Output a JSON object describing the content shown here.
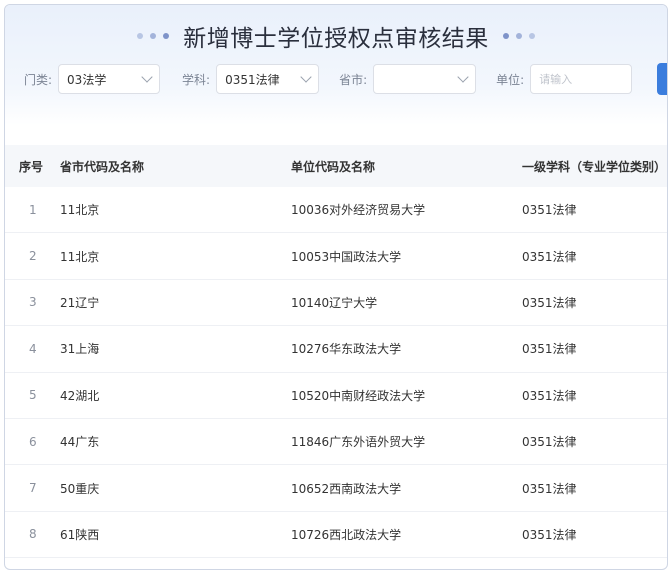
{
  "title": "新增博士学位授权点审核结果",
  "filters": {
    "category_label": "门类:",
    "category_value": "03法学",
    "subject_label": "学科:",
    "subject_value": "0351法律",
    "province_label": "省市:",
    "province_value": "",
    "unit_label": "单位:",
    "unit_placeholder": "请输入"
  },
  "table": {
    "headers": [
      "序号",
      "省市代码及名称",
      "单位代码及名称",
      "一级学科（专业学位类别）"
    ],
    "rows": [
      [
        "1",
        "11北京",
        "10036对外经济贸易大学",
        "0351法律"
      ],
      [
        "2",
        "11北京",
        "10053中国政法大学",
        "0351法律"
      ],
      [
        "3",
        "21辽宁",
        "10140辽宁大学",
        "0351法律"
      ],
      [
        "4",
        "31上海",
        "10276华东政法大学",
        "0351法律"
      ],
      [
        "5",
        "42湖北",
        "10520中南财经政法大学",
        "0351法律"
      ],
      [
        "6",
        "44广东",
        "11846广东外语外贸大学",
        "0351法律"
      ],
      [
        "7",
        "50重庆",
        "10652西南政法大学",
        "0351法律"
      ],
      [
        "8",
        "61陕西",
        "10726西北政法大学",
        "0351法律"
      ]
    ]
  },
  "colors": {
    "accent": "#3b7ddd",
    "header_bg": "#f5f7fa"
  }
}
